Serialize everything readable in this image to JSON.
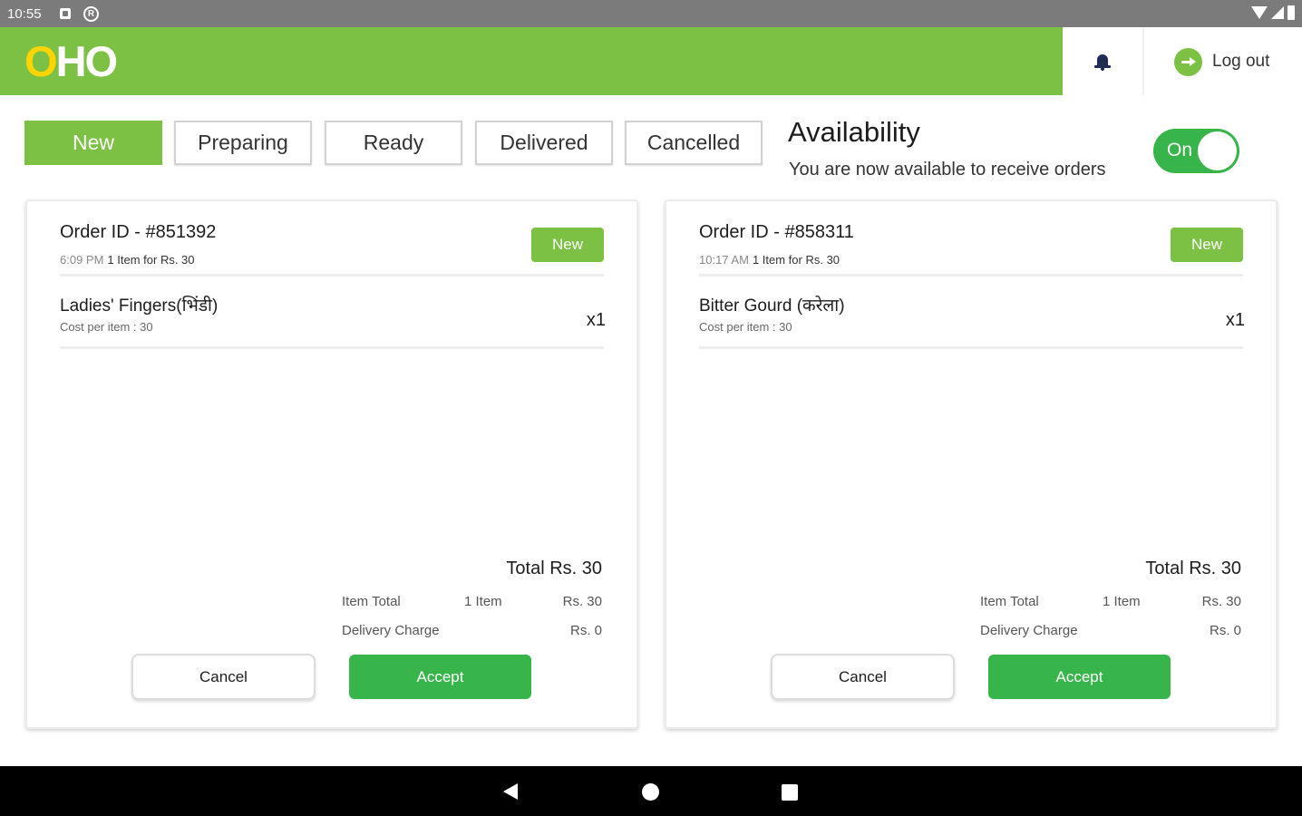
{
  "status_bar": {
    "time": "10:55"
  },
  "header": {
    "logo_o": "O",
    "logo_rest": "HO",
    "logout_label": "Log out",
    "colors": {
      "brand_green": "#7cc143",
      "logo_yellow": "#ffd400",
      "bell": "#1d2b55"
    },
    "icons": [
      "bell-icon",
      "logout-icon"
    ]
  },
  "tabs": [
    {
      "label": "New",
      "active": true
    },
    {
      "label": "Preparing",
      "active": false
    },
    {
      "label": "Ready",
      "active": false
    },
    {
      "label": "Delivered",
      "active": false
    },
    {
      "label": "Cancelled",
      "active": false
    }
  ],
  "availability": {
    "title": "Availability",
    "subtitle": "You are now available to receive orders",
    "toggle_label": "On",
    "toggle_on": true,
    "toggle_color": "#37b54a"
  },
  "orders": [
    {
      "order_id": "Order ID - #851392",
      "time": "6:09 PM",
      "summary": "1 Item for Rs. 30",
      "status": "New",
      "item_name": "Ladies' Fingers(भिंडी)",
      "cost": "Cost per item : 30",
      "qty": "x1",
      "total": "Total Rs. 30",
      "item_total_label": "Item Total",
      "item_count": "1 Item",
      "item_total_value": "Rs. 30",
      "delivery_label": "Delivery Charge",
      "delivery_value": "Rs. 0",
      "cancel_label": "Cancel",
      "accept_label": "Accept"
    },
    {
      "order_id": "Order ID - #858311",
      "time": "10:17 AM",
      "summary": "1 Item for Rs. 30",
      "status": "New",
      "item_name": "Bitter Gourd (करेला)",
      "cost": "Cost per item : 30",
      "qty": "x1",
      "total": "Total Rs. 30",
      "item_total_label": "Item Total",
      "item_count": "1 Item",
      "item_total_value": "Rs. 30",
      "delivery_label": "Delivery Charge",
      "delivery_value": "Rs. 0",
      "cancel_label": "Cancel",
      "accept_label": "Accept"
    }
  ]
}
